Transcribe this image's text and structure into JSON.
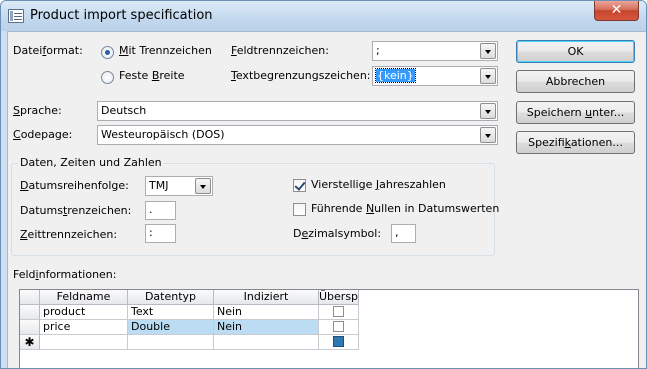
{
  "window": {
    "title": "Product import specification",
    "close": "✕"
  },
  "format": {
    "label_pre": "Datei",
    "label_u": "f",
    "label_post": "ormat:",
    "opt1_u": "M",
    "opt1_post": "it Trennzeichen",
    "opt2_pre": "Feste ",
    "opt2_u": "B",
    "opt2_post": "reite",
    "selected": "Mit Trennzeichen"
  },
  "delimiter": {
    "field_label_u": "F",
    "field_label_post": "eldtrennzeichen:",
    "field_value": ";",
    "text_label_u": "T",
    "text_label_post": "extbegrenzungszeichen:",
    "text_value": "{kein}"
  },
  "language": {
    "label_pre": "",
    "label_u": "S",
    "label_post": "prache:",
    "value": "Deutsch",
    "cp_label_u": "C",
    "cp_label_post": "odepage:",
    "cp_value": "Westeuropäisch (DOS)"
  },
  "buttons": {
    "ok": "OK",
    "cancel": "Abbrechen",
    "save_pre": "Speichern ",
    "save_u": "u",
    "save_post": "nter...",
    "spec_pre": "Spezifi",
    "spec_u": "k",
    "spec_post": "ationen..."
  },
  "datetime": {
    "group_title": "Daten, Zeiten und Zahlen",
    "order_label_u": "D",
    "order_label_post": "atumsreihenfolge:",
    "order_value": "TMJ",
    "date_sep_pre": "Datums",
    "date_sep_u": "t",
    "date_sep_post": "renzeichen:",
    "date_sep_value": ".",
    "time_sep_label_u": "Z",
    "time_sep_label_post": "eittrennzeichen:",
    "time_sep_value": ":",
    "fouryear_pre": "Vierstellige ",
    "fouryear_u": "J",
    "fouryear_post": "ahreszahlen",
    "fouryear_checked": true,
    "leading_pre": "Führende ",
    "leading_u": "N",
    "leading_post": "ullen in Datumswerten",
    "leading_checked": false,
    "decimal_pre": "D",
    "decimal_u": "e",
    "decimal_post": "zimalsymbol:",
    "decimal_value": ","
  },
  "fields": {
    "label_pre": "Feld",
    "label_u": "i",
    "label_post": "nformationen:",
    "columns": [
      "Feldname",
      "Datentyp",
      "Indiziert",
      "Überspr"
    ],
    "rows": [
      {
        "name": "product",
        "type": "Text",
        "indexed": "Nein"
      },
      {
        "name": "price",
        "type": "Double",
        "indexed": "Nein"
      }
    ],
    "new_row_marker": "✱"
  },
  "colors": {
    "accent": "#3c7fb1",
    "selection": "#bcdcf4",
    "close": "#c5452d"
  }
}
